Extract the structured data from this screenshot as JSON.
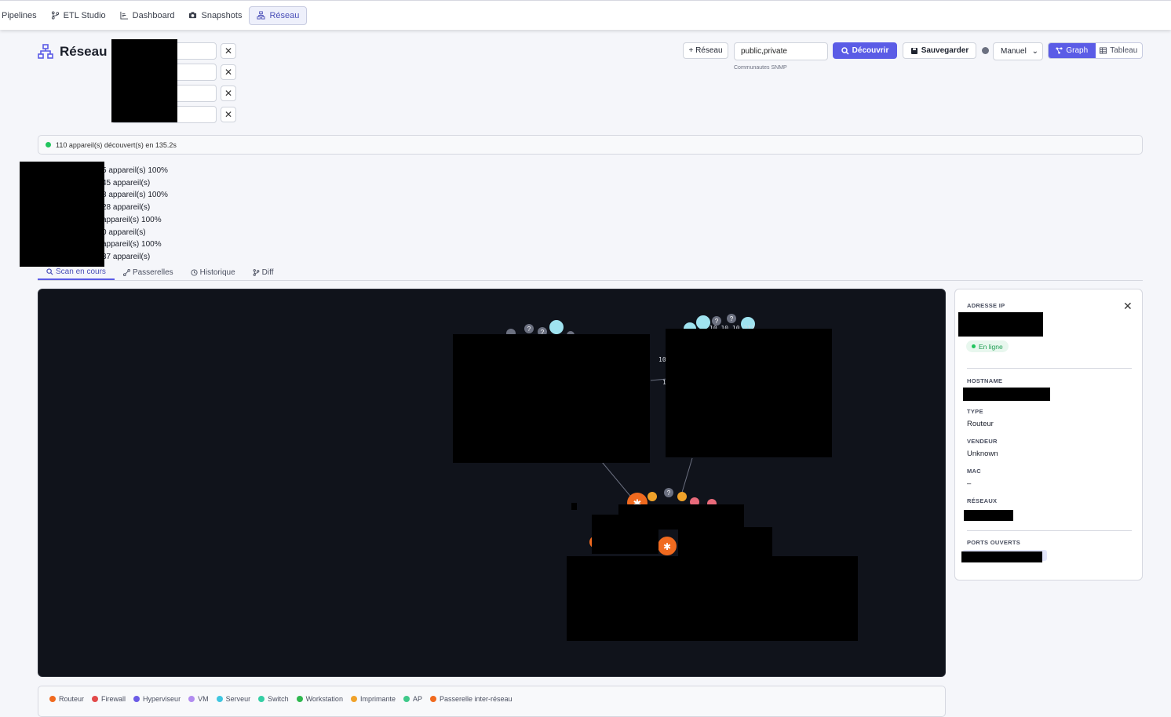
{
  "nav": {
    "items": [
      {
        "label": "Pipelines",
        "icon": "pipelines"
      },
      {
        "label": "ETL Studio",
        "icon": "branch-icon"
      },
      {
        "label": "Dashboard",
        "icon": "chart-icon"
      },
      {
        "label": "Snapshots",
        "icon": "camera-icon"
      },
      {
        "label": "Réseau",
        "icon": "network-icon",
        "active": true
      }
    ]
  },
  "header": {
    "title": "Réseau",
    "add_network_label": "+ Réseau",
    "snmp_value": "public,private",
    "snmp_help": "Communautes SNMP",
    "discover_label": "Découvrir",
    "save_label": "Sauvegarder",
    "mode_value": "Manuel",
    "view_graph_label": "Graph",
    "view_table_label": "Tableau"
  },
  "status": {
    "text": "110 appareil(s) découvert(s) en 135.2s"
  },
  "scan_results": [
    "5 appareil(s) 100%",
    "45 appareil(s)",
    "8 appareil(s) 100%",
    "28 appareil(s)",
    "appareil(s) 100%",
    "0 appareil(s)",
    "appareil(s) 100%",
    "37 appareil(s)"
  ],
  "tabs": [
    "Scan en cours",
    "Passerelles",
    "Historique",
    "Diff"
  ],
  "graph": {
    "labels": [
      "10",
      "1",
      "10.10.10.212"
    ],
    "unknown_glyph": "?"
  },
  "details": {
    "ip_label": "ADRESSE IP",
    "status": "En ligne",
    "hostname_label": "HOSTNAME",
    "type_label": "TYPE",
    "type_value": "Routeur",
    "vendor_label": "VENDEUR",
    "vendor_value": "Unknown",
    "mac_label": "MAC",
    "mac_value": "–",
    "networks_label": "RÉSEAUX",
    "ports_label": "PORTS OUVERTS",
    "close_glyph": "✕"
  },
  "legend": [
    {
      "label": "Routeur",
      "color": "#f06a1f"
    },
    {
      "label": "Firewall",
      "color": "#e24a4a"
    },
    {
      "label": "Hyperviseur",
      "color": "#6b5ce6"
    },
    {
      "label": "VM",
      "color": "#b28cf0"
    },
    {
      "label": "Serveur",
      "color": "#3fc6e0"
    },
    {
      "label": "Switch",
      "color": "#35cfa5"
    },
    {
      "label": "Workstation",
      "color": "#2fb84f"
    },
    {
      "label": "Imprimante",
      "color": "#f0a22a"
    },
    {
      "label": "AP",
      "color": "#3fc98a"
    },
    {
      "label": "Passerelle inter-réseau",
      "color": "#f06a1f"
    }
  ]
}
